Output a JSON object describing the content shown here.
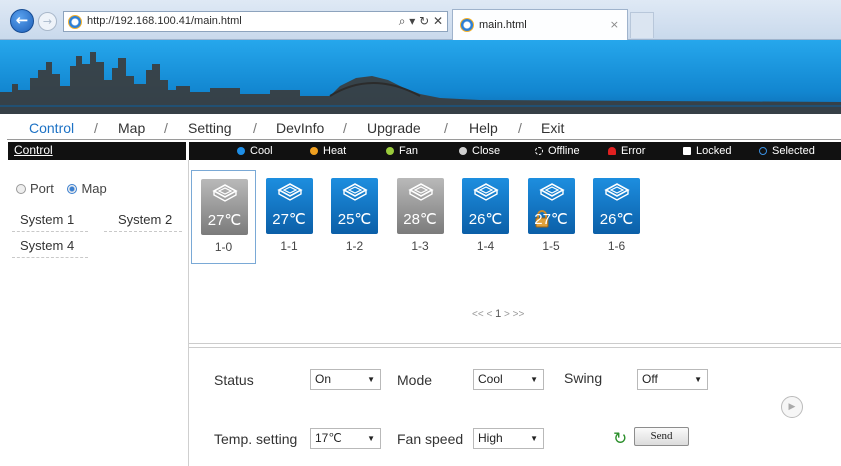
{
  "browser": {
    "url": "http://192.168.100.41/main.html",
    "address_tools": "⌕ ▾ ↻ ✕",
    "tab_title": "main.html",
    "tab_close": "×"
  },
  "menu": {
    "items": [
      "Control",
      "Map",
      "Setting",
      "DevInfo",
      "Upgrade",
      "Help",
      "Exit"
    ],
    "separator": "/",
    "active": "Control"
  },
  "sidebar": {
    "header": "Control",
    "view_options": [
      "Port",
      "Map"
    ],
    "view_selected": "Map",
    "systems": [
      "System 1",
      "System 2",
      "System 4"
    ]
  },
  "legend": [
    {
      "label": "Cool",
      "color": "#1e8ee6",
      "icon": "dot"
    },
    {
      "label": "Heat",
      "color": "#f0a020",
      "icon": "dot"
    },
    {
      "label": "Fan",
      "color": "#9acb3c",
      "icon": "dot"
    },
    {
      "label": "Close",
      "color": "#d0d0d0",
      "icon": "dot"
    },
    {
      "label": "Offline",
      "color": "#ffffff",
      "icon": "dashed-circle"
    },
    {
      "label": "Error",
      "color": "#e02020",
      "icon": "alarm-icon"
    },
    {
      "label": "Locked",
      "color": "#ffffff",
      "icon": "lock-icon"
    },
    {
      "label": "Selected",
      "color": "#3a8fe0",
      "icon": "ring"
    }
  ],
  "devices": [
    {
      "id": "1-0",
      "temp": "27℃",
      "state": "off",
      "selected": true,
      "locked": false
    },
    {
      "id": "1-1",
      "temp": "27℃",
      "state": "cool",
      "selected": false,
      "locked": false
    },
    {
      "id": "1-2",
      "temp": "25℃",
      "state": "cool",
      "selected": false,
      "locked": false
    },
    {
      "id": "1-3",
      "temp": "28℃",
      "state": "off",
      "selected": false,
      "locked": false
    },
    {
      "id": "1-4",
      "temp": "26℃",
      "state": "cool",
      "selected": false,
      "locked": false
    },
    {
      "id": "1-5",
      "temp": "27℃",
      "state": "cool",
      "selected": false,
      "locked": true
    },
    {
      "id": "1-6",
      "temp": "26℃",
      "state": "cool",
      "selected": false,
      "locked": false
    }
  ],
  "pager": {
    "prev": "<< <",
    "current": "1",
    "next": "> >>"
  },
  "controls": {
    "status_label": "Status",
    "status_value": "On",
    "mode_label": "Mode",
    "mode_value": "Cool",
    "swing_label": "Swing",
    "swing_value": "Off",
    "temp_label": "Temp. setting",
    "temp_value": "17℃",
    "fan_label": "Fan speed",
    "fan_value": "High",
    "send_label": "Send"
  }
}
